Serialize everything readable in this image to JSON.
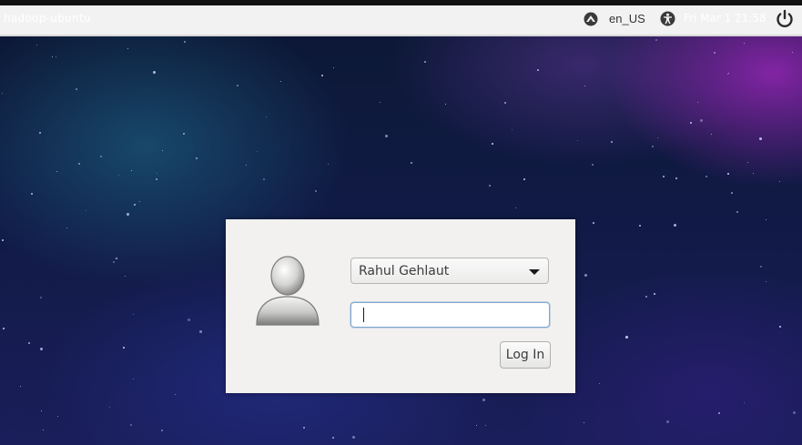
{
  "topbar": {
    "hostname": "hadoop-ubuntu",
    "language": "en_US",
    "clock": "Fri Mar 1 21:58",
    "icons": {
      "language": "keyboard-layout-icon",
      "accessibility": "accessibility-icon",
      "power": "power-icon"
    }
  },
  "login": {
    "selected_user": "Rahul Gehlaut",
    "password_value": "",
    "login_label": "Log In",
    "avatar_icon": "default-user-avatar-icon"
  },
  "colors": {
    "topbar_bg": "#f2f2f2",
    "dialog_bg": "#f2f1f0",
    "focus_border": "#7fa6d0"
  }
}
